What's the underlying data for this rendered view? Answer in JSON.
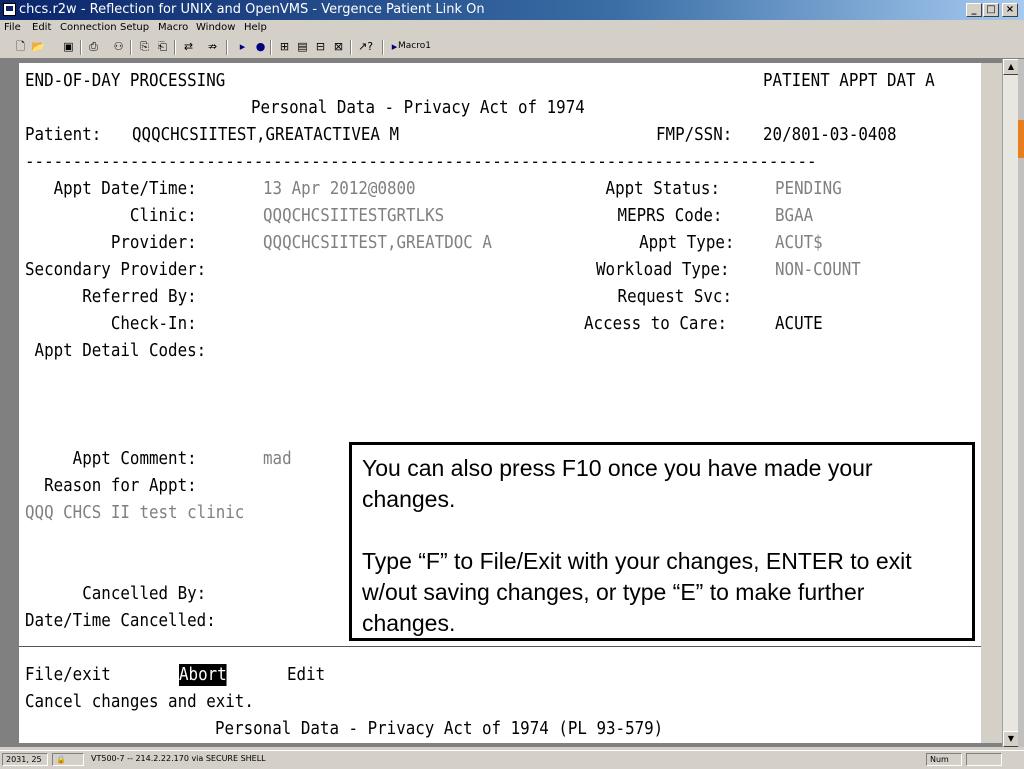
{
  "window": {
    "title": "chcs.r2w - Reflection for UNIX and OpenVMS - Vergence Patient Link On",
    "buttons": {
      "minimize": "_",
      "restore": "□",
      "close": "×"
    }
  },
  "menu": [
    "File",
    "Edit",
    "Connection",
    "Setup",
    "Macro",
    "Window",
    "Help"
  ],
  "toolbar": {
    "macro_label": "Macro1"
  },
  "terminal": {
    "header_left": "END-OF-DAY PROCESSING",
    "header_right": "PATIENT APPT DAT A",
    "privacy_title": "Personal Data - Privacy Act of 1974",
    "patient_label": "Patient:",
    "patient_name": "QQQCHCSIITEST,GREATACTIVEA M",
    "fmp_label": "FMP/SSN:",
    "fmp_value": "20/801-03-0408",
    "divider": "-----------------------------------------------------------------------------------",
    "fields_left": [
      {
        "label": "   Appt Date/Time:",
        "value": "13 Apr 2012@0800"
      },
      {
        "label": "           Clinic:",
        "value": "QQQCHCSIITESTGRTLKS"
      },
      {
        "label": "         Provider:",
        "value": "QQQCHCSIITEST,GREATDOC A"
      },
      {
        "label": "Secondary Provider:",
        "value": ""
      },
      {
        "label": "      Referred By:",
        "value": ""
      },
      {
        "label": "         Check-In:",
        "value": ""
      },
      {
        "label": " Appt Detail Codes:",
        "value": ""
      }
    ],
    "fields_right": [
      {
        "label": " Appt Status:",
        "value": "PENDING",
        "gray": true
      },
      {
        "label": " MEPRS Code:",
        "value": "BGAA",
        "gray": true
      },
      {
        "label": "  Appt Type:",
        "value": "ACUT$",
        "gray": true
      },
      {
        "label": "Workload Type:",
        "value": "NON-COUNT",
        "gray": true
      },
      {
        "label": " Request Svc:",
        "value": "",
        "gray": false
      },
      {
        "label": "Access to Care:",
        "value": "ACUTE",
        "gray": false
      }
    ],
    "appt_comment_label": "     Appt Comment:",
    "appt_comment_value": "mad",
    "reason_label": "  Reason for Appt:",
    "reason_value": "QQQ CHCS II test clinic",
    "cancelled_by_label": "      Cancelled By:",
    "date_cancelled_label": "Date/Time Cancelled:",
    "options": {
      "file": "File/exit",
      "abort": "Abort",
      "edit": "Edit"
    },
    "option_help": "Cancel changes and exit.",
    "footer": "Personal Data - Privacy Act of 1974 (PL 93-579)"
  },
  "callout": {
    "para1": "You can also press F10 once you have made your changes.",
    "para2": "Type “F” to File/Exit with your changes, ENTER to exit w/out saving changes, or type “E” to make further changes."
  },
  "status": {
    "position": "2031, 25",
    "connection": "VT500-7 -- 214.2.22.170 via SECURE SHELL",
    "num": "Num"
  }
}
